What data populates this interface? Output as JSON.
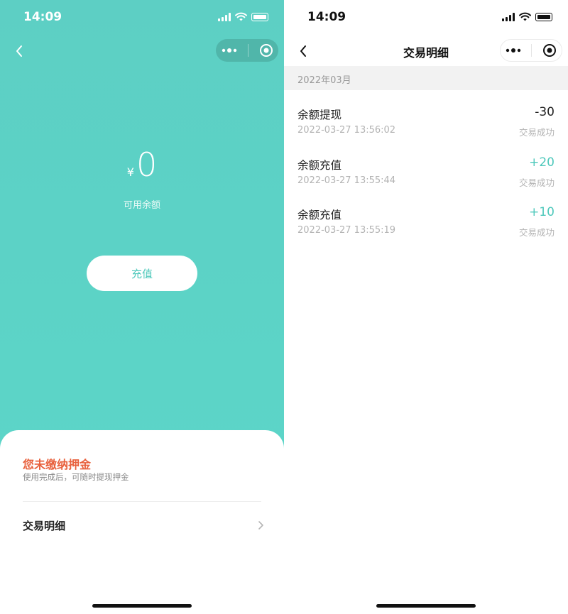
{
  "left": {
    "status_time": "14:09",
    "currency_symbol": "¥",
    "balance": "0",
    "balance_label": "可用余额",
    "recharge_button": "充值",
    "deposit_title": "您未缴纳押金",
    "deposit_subtitle": "使用完成后，可随时提现押金",
    "detail_link": "交易明细",
    "detail_arrow": "›"
  },
  "right": {
    "status_time": "14:09",
    "nav_title": "交易明细",
    "month": "2022年03月",
    "transactions": [
      {
        "title": "余额提现",
        "datetime": "2022-03-27 13:56:02",
        "amount": "-30",
        "status": "交易成功"
      },
      {
        "title": "余额充值",
        "datetime": "2022-03-27 13:55:44",
        "amount": "+20",
        "status": "交易成功"
      },
      {
        "title": "余额充值",
        "datetime": "2022-03-27 13:55:19",
        "amount": "+10",
        "status": "交易成功"
      }
    ]
  },
  "colors": {
    "teal_background": "#5bd3c7",
    "accent_teal": "#4ec8bb",
    "deposit_warning": "#e8603c"
  },
  "icons": {
    "back": "back-arrow-icon",
    "more": "more-dots-icon",
    "close": "target-close-icon",
    "signal": "signal-icon",
    "wifi": "wifi-icon",
    "battery": "battery-icon",
    "chevron": "chevron-right-icon"
  }
}
